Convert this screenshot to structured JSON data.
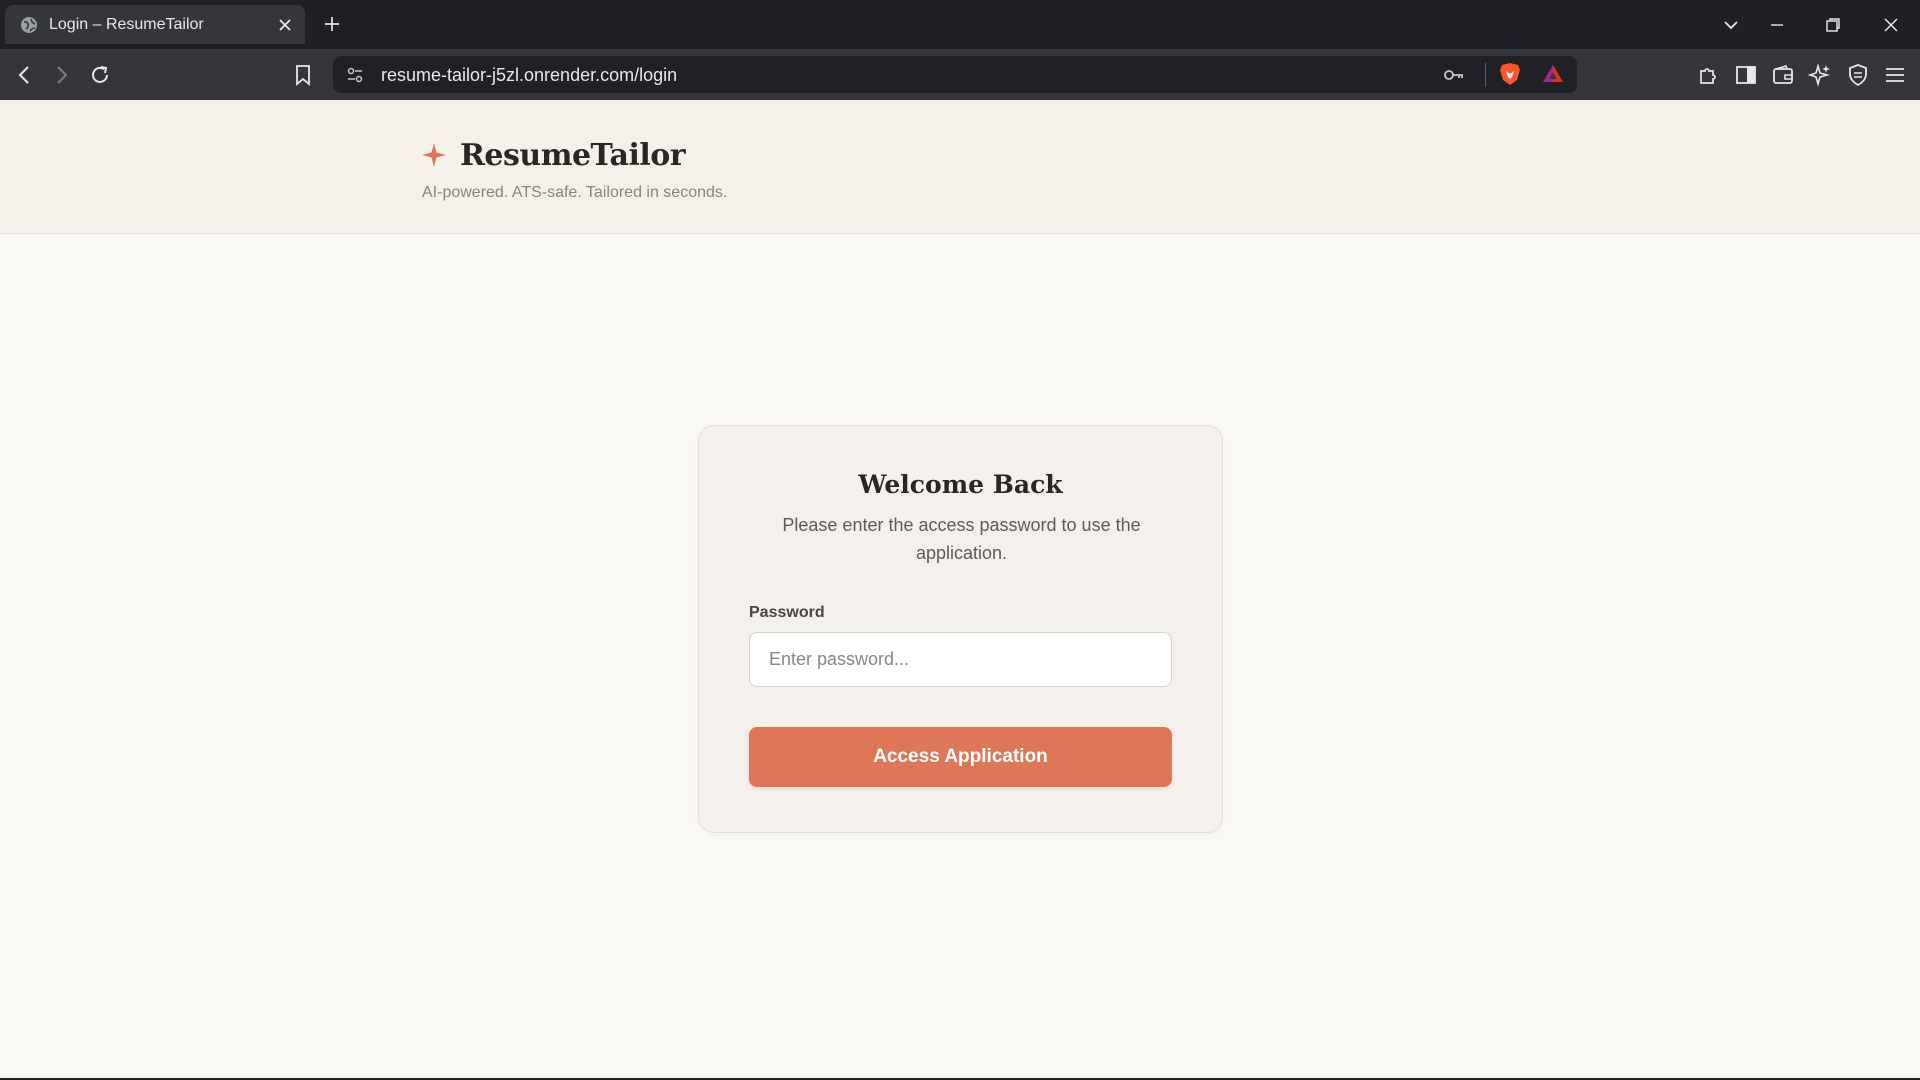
{
  "browser": {
    "tab": {
      "title": "Login – ResumeTailor",
      "favicon": "globe-icon"
    },
    "address_bar": {
      "url": "resume-tailor-j5zl.onrender.com/login"
    }
  },
  "header": {
    "brand_icon": "sparkle-icon",
    "brand_color": "#dd7757",
    "title": "ResumeTailor",
    "tagline": "AI-powered. ATS-safe. Tailored in seconds."
  },
  "login": {
    "title": "Welcome Back",
    "subtitle": "Please enter the access password to use the application.",
    "password_label": "Password",
    "password_placeholder": "Enter password...",
    "password_value": "",
    "submit_label": "Access Application",
    "accent_color": "#dd7757"
  }
}
